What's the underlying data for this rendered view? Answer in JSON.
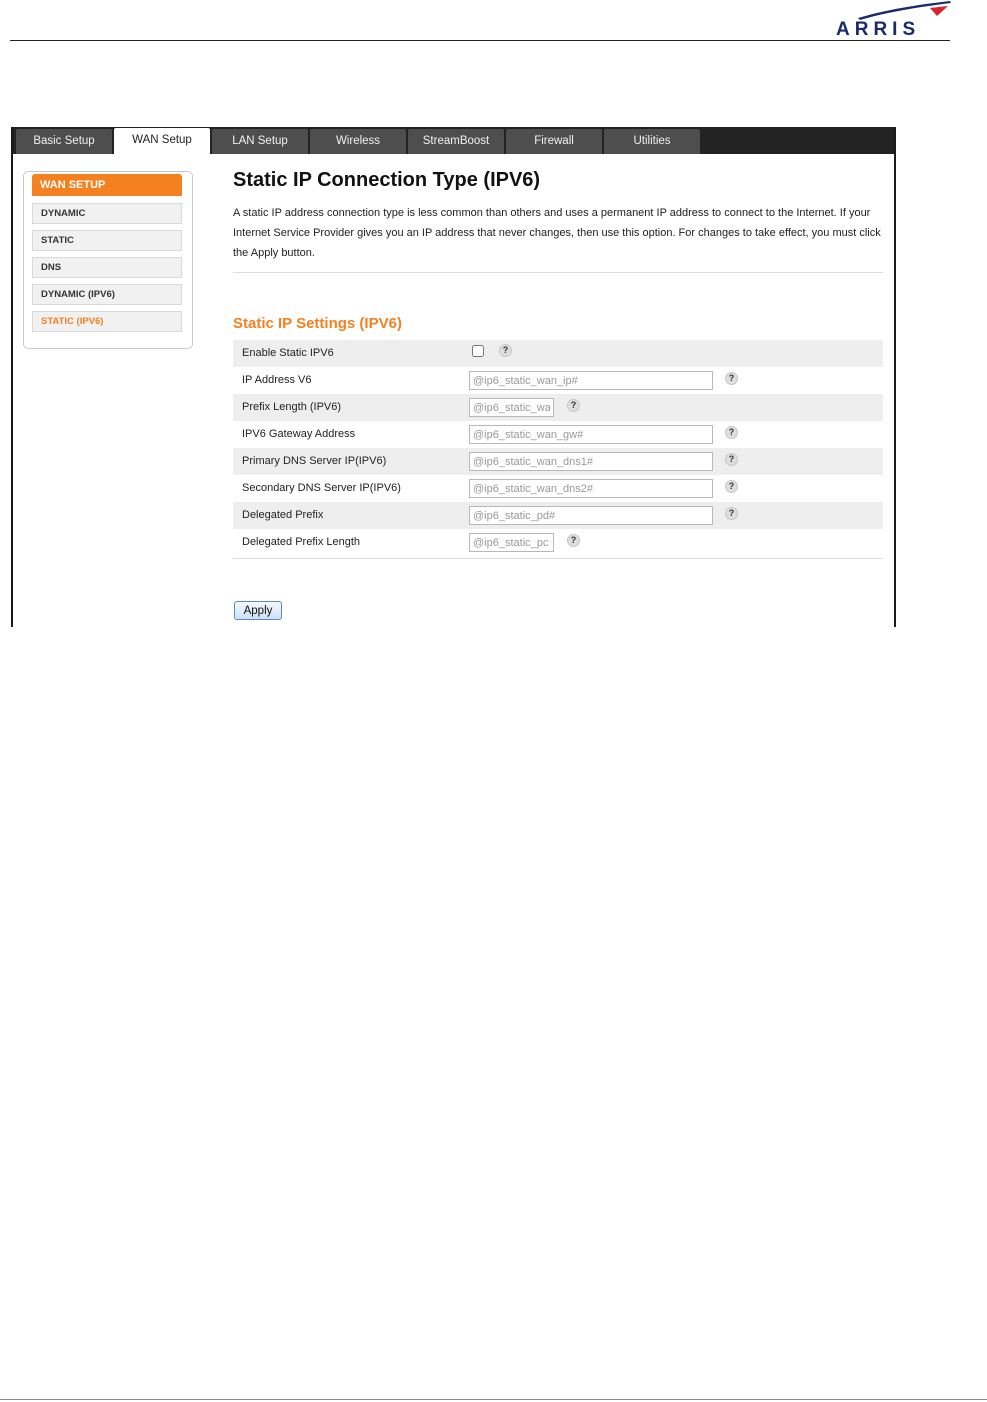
{
  "brand": {
    "logo_text": "ARRIS",
    "navy": "#1b2a6b",
    "red": "#d9252a"
  },
  "tabs": [
    {
      "label": "Basic Setup"
    },
    {
      "label": "WAN Setup",
      "active": true
    },
    {
      "label": "LAN Setup"
    },
    {
      "label": "Wireless"
    },
    {
      "label": "StreamBoost"
    },
    {
      "label": "Firewall"
    },
    {
      "label": "Utilities"
    }
  ],
  "sidebar": {
    "heading": "WAN SETUP",
    "items": [
      {
        "label": "DYNAMIC"
      },
      {
        "label": "STATIC"
      },
      {
        "label": "DNS"
      },
      {
        "label": "DYNAMIC (IPV6)"
      },
      {
        "label": "STATIC (IPV6)",
        "active": true
      }
    ]
  },
  "main": {
    "title": "Static IP Connection Type (IPV6)",
    "intro": "A static IP address connection type is less common than others and uses a permanent IP address to connect to the Internet. If your Internet Service Provider gives you an IP address that never changes, then use this option. For changes to take effect, you must click the Apply button.",
    "section_title": "Static IP Settings (IPV6)",
    "rows": [
      {
        "label": "Enable Static IPV6",
        "type": "checkbox",
        "checked": false
      },
      {
        "label": "IP Address V6",
        "type": "text",
        "value": "@ip6_static_wan_ip#"
      },
      {
        "label": "Prefix Length (IPV6)",
        "type": "text",
        "value": "@ip6_static_wa"
      },
      {
        "label": "IPV6 Gateway Address",
        "type": "text",
        "value": "@ip6_static_wan_gw#"
      },
      {
        "label": "Primary DNS Server IP(IPV6)",
        "type": "text",
        "value": "@ip6_static_wan_dns1#"
      },
      {
        "label": "Secondary DNS Server IP(IPV6)",
        "type": "text",
        "value": "@ip6_static_wan_dns2#"
      },
      {
        "label": "Delegated Prefix",
        "type": "text",
        "value": "@ip6_static_pd#"
      },
      {
        "label": "Delegated Prefix Length",
        "type": "text",
        "value": "@ip6_static_pc"
      }
    ],
    "help_glyph": "?",
    "apply_label": "Apply"
  },
  "icons": {
    "help": "help-question-icon",
    "logo": "arris-swoosh-icon"
  },
  "colors": {
    "accent": "#f4801f",
    "tabbar": "#232323",
    "tab": "#4e4e4e"
  }
}
